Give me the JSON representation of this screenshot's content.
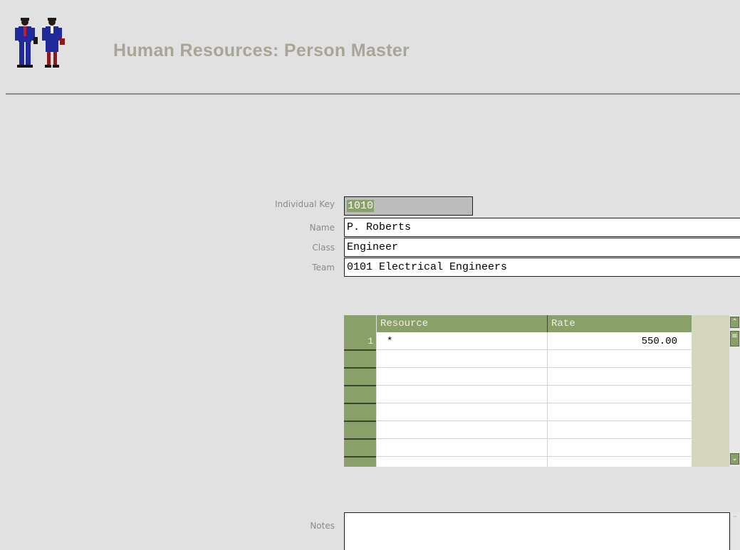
{
  "header": {
    "title": "Human Resources: Person Master",
    "logo_icon": "two-people-icon"
  },
  "form": {
    "individual_key": {
      "label": "Individual Key",
      "value": "1010"
    },
    "name": {
      "label": "Name",
      "value": "P. Roberts"
    },
    "class": {
      "label": "Class",
      "value": "Engineer"
    },
    "team": {
      "label": "Team",
      "value": "0101 Electrical Engineers"
    },
    "notes": {
      "label": "Notes",
      "value": ""
    }
  },
  "grid": {
    "columns": [
      "Resource",
      "Rate"
    ],
    "rows": [
      {
        "num": "1",
        "resource": "*",
        "rate": "550.00"
      }
    ],
    "scroll_up_icon": "chevron-up-icon",
    "scroll_down_icon": "chevron-down-icon"
  },
  "colors": {
    "accent_green": "#8aa069",
    "title_gray": "#a8a596",
    "background": "#e1e1e1"
  }
}
